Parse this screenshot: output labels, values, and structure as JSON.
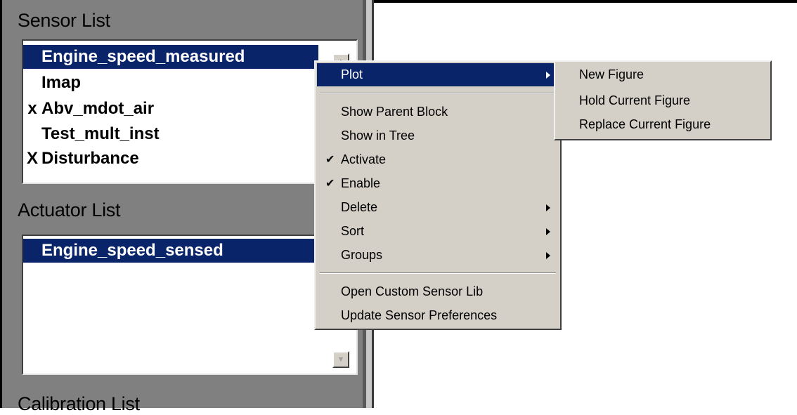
{
  "sensor_list": {
    "title": "Sensor List",
    "items": [
      {
        "mark": "",
        "label": "Engine_speed_measured",
        "selected": true
      },
      {
        "mark": "",
        "label": "Imap",
        "selected": false
      },
      {
        "mark": "x",
        "label": "Abv_mdot_air",
        "selected": false
      },
      {
        "mark": "",
        "label": "Test_mult_inst",
        "selected": false
      },
      {
        "mark": "X",
        "label": "Disturbance",
        "selected": false
      }
    ],
    "scroll_up_icon": "triangle-up"
  },
  "actuator_list": {
    "title": "Actuator List",
    "items": [
      {
        "mark": "",
        "label": "Engine_speed_sensed",
        "selected": true
      }
    ],
    "scroll_down_icon": "triangle-down"
  },
  "calibration_list": {
    "title": "Calibration List"
  },
  "context_menu": {
    "items": [
      {
        "label": "Plot",
        "check": "",
        "submenu": true,
        "active": true
      },
      {
        "label": "Show Parent Block",
        "check": "",
        "submenu": false
      },
      {
        "label": "Show in Tree",
        "check": "",
        "submenu": false
      },
      {
        "label": "Activate",
        "check": "✔",
        "submenu": false
      },
      {
        "label": "Enable",
        "check": "✔",
        "submenu": false
      },
      {
        "label": "Delete",
        "check": "",
        "submenu": true
      },
      {
        "label": "Sort",
        "check": "",
        "submenu": true
      },
      {
        "label": "Groups",
        "check": "",
        "submenu": true
      },
      {
        "label": "Open Custom Sensor Lib",
        "check": "",
        "submenu": false
      },
      {
        "label": "Update Sensor Preferences",
        "check": "",
        "submenu": false
      }
    ]
  },
  "plot_submenu": {
    "items": [
      "New Figure",
      "Hold Current Figure",
      "Replace Current Figure"
    ]
  },
  "colors": {
    "selection": "#0a246a",
    "menu_bg": "#d4d0c8",
    "panel_bg": "#808080"
  }
}
